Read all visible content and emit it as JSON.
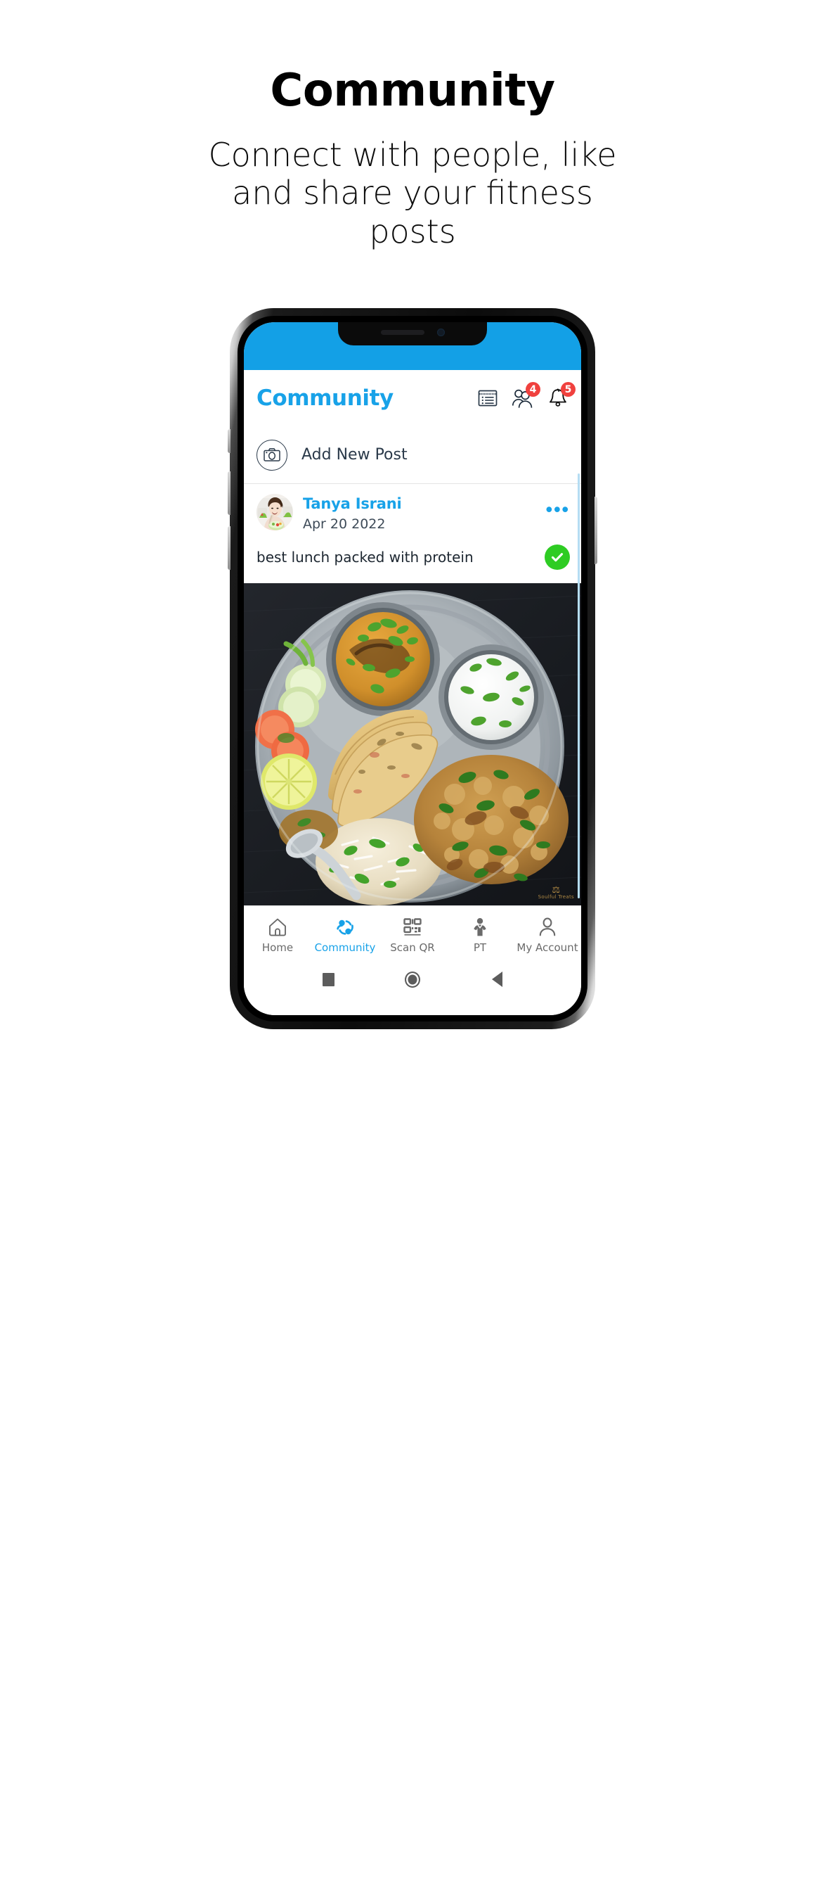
{
  "promo": {
    "title": "Community",
    "subtitle": "Connect with people, like and share your fitness posts"
  },
  "colors": {
    "brand_blue": "#18A2E8",
    "status_bar": "#13A0E6",
    "badge_red": "#F0413E",
    "check_green": "#2ECC23",
    "nav_inactive": "#6A6A6A",
    "scrollbar": "#B5DDF3"
  },
  "app": {
    "header": {
      "title": "Community",
      "icons": [
        {
          "name": "feed-list-icon",
          "badge": null
        },
        {
          "name": "friends-icon",
          "badge": "4"
        },
        {
          "name": "notifications-bell-icon",
          "badge": "5"
        }
      ]
    },
    "add_post": {
      "icon": "camera-icon",
      "label": "Add New Post"
    },
    "post": {
      "avatar_icon": "user-avatar-photo",
      "author": "Tanya Israni",
      "date": "Apr 20 2022",
      "more_label": "•••",
      "caption": "best lunch packed with protein",
      "verified_icon": "check-circle-icon",
      "photo_alt": "indian-thali-meal-photo",
      "photo_watermark": "Soulful Treats"
    },
    "bottom_nav": [
      {
        "label": "Home",
        "icon": "home-icon",
        "active": false
      },
      {
        "label": "Community",
        "icon": "community-icon",
        "active": true
      },
      {
        "label": "Scan QR",
        "icon": "qr-code-icon",
        "active": false
      },
      {
        "label": "PT",
        "icon": "personal-trainer-icon",
        "active": false
      },
      {
        "label": "My Account",
        "icon": "account-person-icon",
        "active": false
      }
    ],
    "system_nav": [
      {
        "name": "recents-square-button"
      },
      {
        "name": "home-circle-button"
      },
      {
        "name": "back-triangle-button"
      }
    ]
  }
}
